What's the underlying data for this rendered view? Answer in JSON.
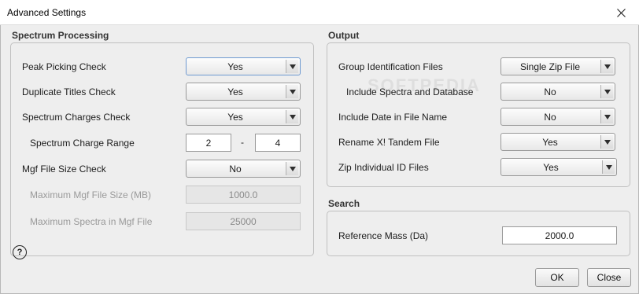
{
  "window": {
    "title": "Advanced Settings"
  },
  "spectrum_processing": {
    "title": "Spectrum Processing",
    "rows": {
      "peak_picking": {
        "label": "Peak Picking Check",
        "value": "Yes"
      },
      "duplicate_titles": {
        "label": "Duplicate Titles Check",
        "value": "Yes"
      },
      "spectrum_charges": {
        "label": "Spectrum Charges Check",
        "value": "Yes"
      },
      "charge_range": {
        "label": "Spectrum Charge Range",
        "min": "2",
        "separator": "-",
        "max": "4"
      },
      "mgf_size_check": {
        "label": "Mgf File Size Check",
        "value": "No"
      },
      "max_mgf_size": {
        "label": "Maximum Mgf File Size (MB)",
        "value": "1000.0"
      },
      "max_spectra": {
        "label": "Maximum Spectra in Mgf File",
        "value": "25000"
      }
    }
  },
  "output": {
    "title": "Output",
    "rows": {
      "group_id_files": {
        "label": "Group Identification Files",
        "value": "Single Zip File"
      },
      "include_spectra_db": {
        "label": "Include Spectra and Database",
        "value": "No"
      },
      "include_date": {
        "label": "Include Date in File Name",
        "value": "No"
      },
      "rename_tandem": {
        "label": "Rename X! Tandem File",
        "value": "Yes"
      },
      "zip_individual": {
        "label": "Zip Individual ID Files",
        "value": "Yes"
      }
    }
  },
  "search": {
    "title": "Search",
    "reference_mass": {
      "label": "Reference Mass (Da)",
      "value": "2000.0"
    }
  },
  "footer": {
    "help": "?",
    "ok": "OK",
    "close": "Close"
  },
  "watermark": "SOFTPEDIA"
}
